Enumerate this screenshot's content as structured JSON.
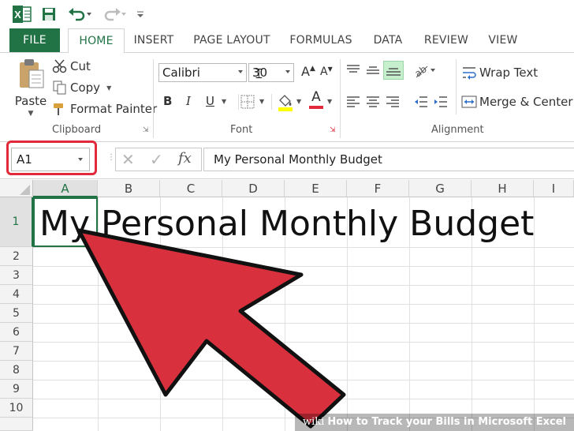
{
  "quick_access": {
    "undo_icon": "undo-icon",
    "redo_icon": "redo-icon",
    "save_icon": "save-icon",
    "customize_icon": "customize-qat-icon"
  },
  "tabs": [
    "FILE",
    "HOME",
    "INSERT",
    "PAGE LAYOUT",
    "FORMULAS",
    "DATA",
    "REVIEW",
    "VIEW"
  ],
  "clipboard": {
    "paste": "Paste",
    "cut": "Cut",
    "copy": "Copy",
    "format_painter": "Format Painter",
    "group": "Clipboard"
  },
  "font": {
    "name": "Calibri",
    "size": "30",
    "bold": "B",
    "italic": "I",
    "underline": "U",
    "color_letter": "A",
    "group": "Font"
  },
  "alignment": {
    "wrap_text": "Wrap Text",
    "merge_center": "Merge & Center",
    "group": "Alignment"
  },
  "formula_bar": {
    "name_box": "A1",
    "fx": "fx",
    "content": "My Personal Monthly Budget"
  },
  "columns": [
    "A",
    "B",
    "C",
    "D",
    "E",
    "F",
    "G",
    "H",
    "I"
  ],
  "rows": [
    "1",
    "2",
    "3",
    "4",
    "5",
    "6",
    "7",
    "8",
    "9",
    "10"
  ],
  "cell_a1": "My Personal Monthly Budget",
  "watermark": {
    "brand": "wiki",
    "text": "How to Track your Bills in Microsoft Excel"
  },
  "colors": {
    "excel_green": "#217346",
    "highlight_red": "#e0293a",
    "arrow_red": "#d9303d"
  }
}
